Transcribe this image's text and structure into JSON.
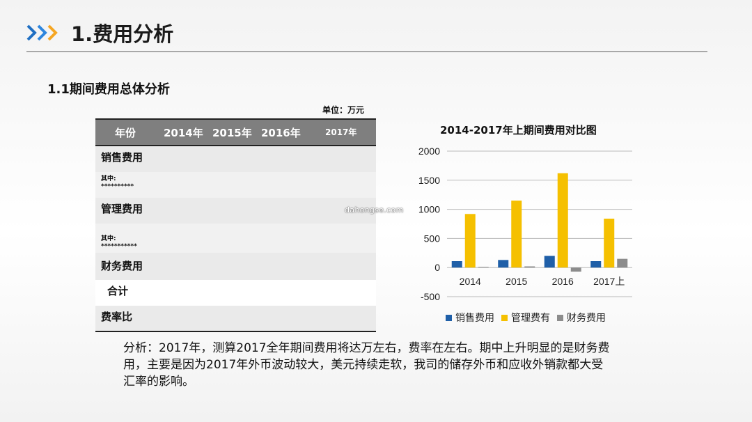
{
  "header": {
    "title": "1.费用分析",
    "chevron_color": "#1f6fc3",
    "chevron_accent": "#f5a623"
  },
  "section": {
    "subtitle": "1.1期间费用总体分析",
    "unit_label": "单位：万元"
  },
  "table": {
    "headers": [
      "年份",
      "2014年",
      "2015年",
      "2016年",
      "2017年"
    ],
    "rows": [
      {
        "label": "销售费用"
      },
      {
        "label": "其中:",
        "note": "**********"
      },
      {
        "label": "管理费用"
      },
      {
        "label": "其中:",
        "note": "***********"
      },
      {
        "label": "财务费用"
      },
      {
        "label": "合计"
      },
      {
        "label": "费率比"
      }
    ]
  },
  "watermark": "dahongse.com",
  "chart_data": {
    "type": "bar",
    "title": "2014-2017年上期间费用对比图",
    "categories": [
      "2014",
      "2015",
      "2016",
      "2017上"
    ],
    "series": [
      {
        "name": "销售费用",
        "color": "#1f5fa8",
        "values": [
          110,
          130,
          200,
          110
        ]
      },
      {
        "name": "管理费有",
        "color": "#f5c000",
        "values": [
          920,
          1150,
          1620,
          840
        ]
      },
      {
        "name": "财务费用",
        "color": "#8c8c8c",
        "values": [
          10,
          20,
          -70,
          150
        ]
      }
    ],
    "ylim": [
      -500,
      2000
    ],
    "yticks": [
      2000,
      1500,
      1000,
      500,
      0,
      -500
    ],
    "grid": true,
    "legend": "bottom"
  },
  "analysis": {
    "text": "分析：2017年，测算2017全年期间费用将达万左右，费率在左右。期中上升明显的是财务费用，主要是因为2017年外币波动较大，美元持续走软，我司的储存外币和应收外销款都大受汇率的影响。"
  }
}
